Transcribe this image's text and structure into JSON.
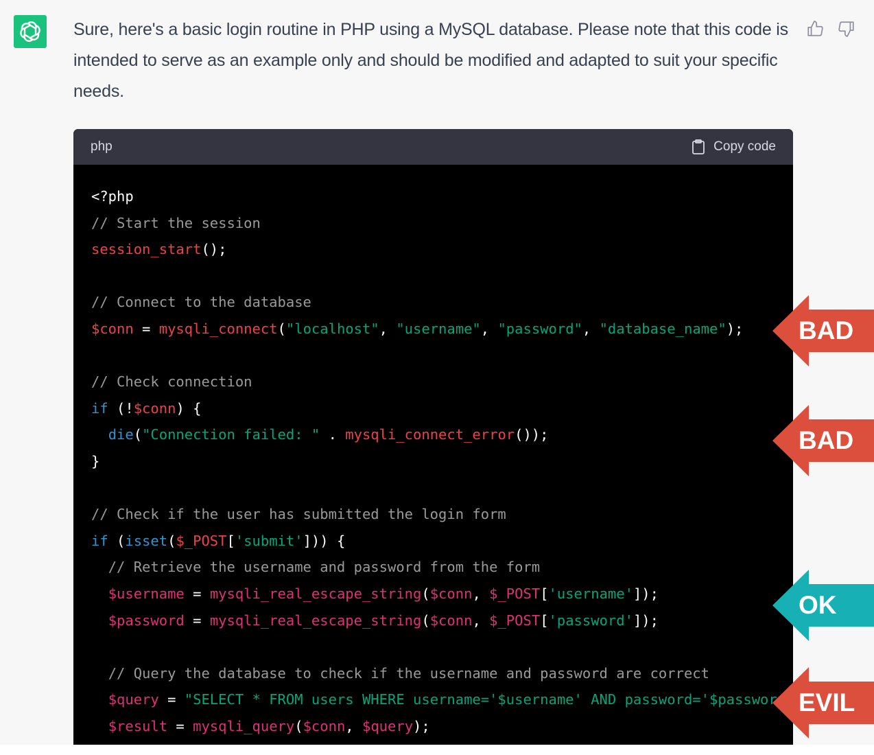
{
  "message": {
    "text": "Sure, here's a basic login routine in PHP using a MySQL database. Please note that this code is intended to serve as an example only and should be modified and adapted to suit your specific needs."
  },
  "avatar": {
    "icon": "openai-logo-icon",
    "color": "#19c37d"
  },
  "feedback": {
    "like_icon": "thumbs-up-icon",
    "dislike_icon": "thumbs-down-icon"
  },
  "code_block": {
    "language": "php",
    "copy_label": "Copy code",
    "copy_icon": "clipboard-icon",
    "lines": [
      [
        [
          "<?php",
          "plain"
        ]
      ],
      [
        [
          "// Start the session",
          "com"
        ]
      ],
      [
        [
          "session_start",
          "red"
        ],
        [
          "();",
          "plain"
        ]
      ],
      [],
      [
        [
          "// Connect to the database",
          "com"
        ]
      ],
      [
        [
          "$conn",
          "red"
        ],
        [
          " = ",
          "plain"
        ],
        [
          "mysqli_connect",
          "red"
        ],
        [
          "(",
          "plain"
        ],
        [
          "\"localhost\"",
          "str"
        ],
        [
          ", ",
          "plain"
        ],
        [
          "\"username\"",
          "str"
        ],
        [
          ", ",
          "plain"
        ],
        [
          "\"password\"",
          "str"
        ],
        [
          ", ",
          "plain"
        ],
        [
          "\"database_name\"",
          "str"
        ],
        [
          ");",
          "plain"
        ]
      ],
      [],
      [
        [
          "// Check connection",
          "com"
        ]
      ],
      [
        [
          "if",
          "kw"
        ],
        [
          " (!",
          "plain"
        ],
        [
          "$conn",
          "red"
        ],
        [
          ") {",
          "plain"
        ]
      ],
      [
        [
          "  ",
          "plain"
        ],
        [
          "die",
          "kw"
        ],
        [
          "(",
          "plain"
        ],
        [
          "\"Connection failed: \"",
          "str"
        ],
        [
          " . ",
          "plain"
        ],
        [
          "mysqli_connect_error",
          "red"
        ],
        [
          "());",
          "plain"
        ]
      ],
      [
        [
          "}",
          "plain"
        ]
      ],
      [],
      [
        [
          "// Check if the user has submitted the login form",
          "com"
        ]
      ],
      [
        [
          "if",
          "kw"
        ],
        [
          " (",
          "plain"
        ],
        [
          "isset",
          "kw"
        ],
        [
          "(",
          "plain"
        ],
        [
          "$_POST",
          "red"
        ],
        [
          "[",
          "plain"
        ],
        [
          "'submit'",
          "str"
        ],
        [
          "])) {",
          "plain"
        ]
      ],
      [
        [
          "  ",
          "plain"
        ],
        [
          "// Retrieve the username and password from the form",
          "com"
        ]
      ],
      [
        [
          "  ",
          "plain"
        ],
        [
          "$username",
          "fn"
        ],
        [
          " = ",
          "plain"
        ],
        [
          "mysqli_real_escape_string",
          "fn"
        ],
        [
          "(",
          "plain"
        ],
        [
          "$conn",
          "fn"
        ],
        [
          ", ",
          "plain"
        ],
        [
          "$_POST",
          "fn"
        ],
        [
          "[",
          "plain"
        ],
        [
          "'username'",
          "str"
        ],
        [
          "]);",
          "plain"
        ]
      ],
      [
        [
          "  ",
          "plain"
        ],
        [
          "$password",
          "fn"
        ],
        [
          " = ",
          "plain"
        ],
        [
          "mysqli_real_escape_string",
          "fn"
        ],
        [
          "(",
          "plain"
        ],
        [
          "$conn",
          "fn"
        ],
        [
          ", ",
          "plain"
        ],
        [
          "$_POST",
          "fn"
        ],
        [
          "[",
          "plain"
        ],
        [
          "'password'",
          "str"
        ],
        [
          "]);",
          "plain"
        ]
      ],
      [],
      [
        [
          "  ",
          "plain"
        ],
        [
          "// Query the database to check if the username and password are correct",
          "com"
        ]
      ],
      [
        [
          "  ",
          "plain"
        ],
        [
          "$query",
          "fn"
        ],
        [
          " = ",
          "plain"
        ],
        [
          "\"SELECT * FROM users WHERE username='$username' AND password='$password'\"",
          "str"
        ],
        [
          ";",
          "plain"
        ]
      ],
      [
        [
          "  ",
          "plain"
        ],
        [
          "$result",
          "fn"
        ],
        [
          " = ",
          "plain"
        ],
        [
          "mysqli_query",
          "fn"
        ],
        [
          "(",
          "plain"
        ],
        [
          "$conn",
          "fn"
        ],
        [
          ", ",
          "plain"
        ],
        [
          "$query",
          "fn"
        ],
        [
          ");",
          "plain"
        ]
      ]
    ]
  },
  "annotations": [
    {
      "label": "BAD",
      "color": "#dd4f3d"
    },
    {
      "label": "BAD",
      "color": "#dd4f3d"
    },
    {
      "label": "OK",
      "color": "#16b0b5"
    },
    {
      "label": "EVIL",
      "color": "#dd4f3d"
    }
  ]
}
